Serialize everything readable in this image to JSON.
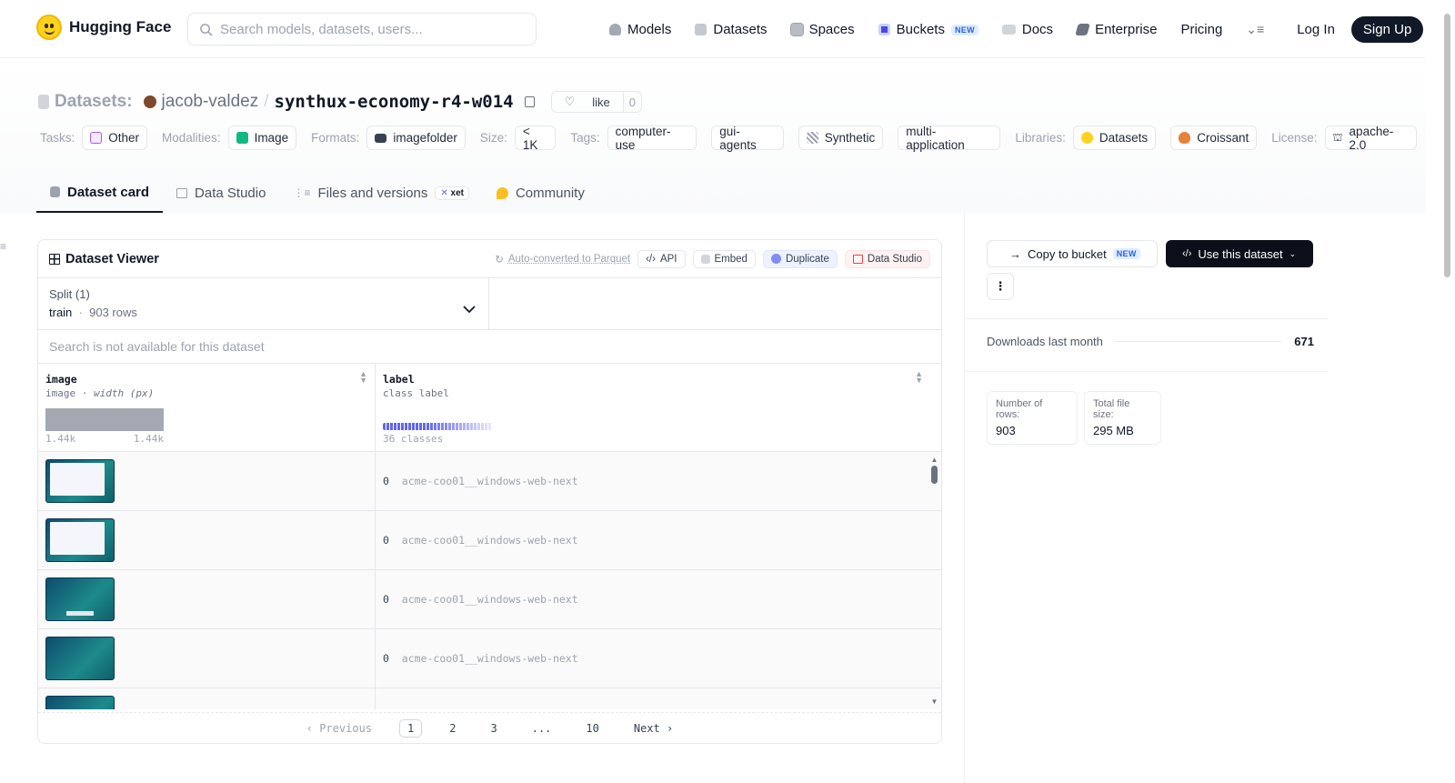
{
  "nav": {
    "logo": "Hugging Face",
    "search_placeholder": "Search models, datasets, users...",
    "links": [
      {
        "label": "Models",
        "icon": "models-icon",
        "color": "#9ca3af"
      },
      {
        "label": "Datasets",
        "icon": "datasets-icon",
        "color": "#9ca3af"
      },
      {
        "label": "Spaces",
        "icon": "spaces-icon",
        "color": "#9ca3af"
      },
      {
        "label": "Buckets",
        "icon": "buckets-icon",
        "color": "#4f46e5"
      },
      {
        "label": "Docs",
        "icon": "docs-icon",
        "color": "#9ca3af"
      },
      {
        "label": "Enterprise",
        "icon": "enterprise-icon",
        "color": "#6b7280"
      },
      {
        "label": "Pricing"
      }
    ],
    "new_badge": "NEW",
    "login": "Log In",
    "signup": "Sign Up"
  },
  "header": {
    "section": "Datasets:",
    "owner": "jacob-valdez",
    "slash": "/",
    "name": "synthux-economy-r4-w014",
    "like": "like",
    "like_count": "0",
    "tags": [
      {
        "label": "Tasks:",
        "items": [
          {
            "text": "Other",
            "icon": "other-icon"
          }
        ]
      },
      {
        "label": "Modalities:",
        "items": [
          {
            "text": "Image",
            "icon": "image-icon"
          }
        ]
      },
      {
        "label": "Formats:",
        "items": [
          {
            "text": "imagefolder",
            "icon": "folder-icon"
          }
        ]
      },
      {
        "label": "Size:",
        "items": [
          {
            "text": "< 1K"
          }
        ]
      },
      {
        "label": "Tags:",
        "items": [
          {
            "text": "computer-use"
          },
          {
            "text": "gui-agents"
          },
          {
            "text": "Synthetic",
            "icon": "synthetic-icon"
          },
          {
            "text": "multi-application"
          }
        ]
      },
      {
        "label": "Libraries:",
        "items": [
          {
            "text": "Datasets",
            "icon": "hf-icon"
          },
          {
            "text": "Croissant",
            "icon": "croissant-icon"
          }
        ]
      },
      {
        "label": "License:",
        "items": [
          {
            "text": "apache-2.0",
            "icon": "license-icon"
          }
        ]
      }
    ]
  },
  "tabs": [
    {
      "label": "Dataset card",
      "active": true
    },
    {
      "label": "Data Studio"
    },
    {
      "label": "Files and versions",
      "badge": "xet"
    },
    {
      "label": "Community"
    }
  ],
  "viewer": {
    "title": "Dataset Viewer",
    "auto_converted": "Auto-converted to Parquet",
    "buttons": [
      "API",
      "Embed",
      "Duplicate",
      "Data Studio"
    ],
    "split_label": "Split (1)",
    "split_value": "train",
    "split_rows": "903 rows",
    "search_na": "Search is not available for this dataset",
    "col1_name": "image",
    "col1_type": "image",
    "col1_sub": "width (px)",
    "col1_min": "1.44k",
    "col1_max": "1.44k",
    "col2_name": "label",
    "col2_type": "class label",
    "col2_classes": "36 classes",
    "rows": [
      {
        "label_index": "0",
        "label_text": "acme-coo01__windows-web-next"
      },
      {
        "label_index": "0",
        "label_text": "acme-coo01__windows-web-next"
      },
      {
        "label_index": "0",
        "label_text": "acme-coo01__windows-web-next"
      },
      {
        "label_index": "0",
        "label_text": "acme-coo01__windows-web-next"
      }
    ],
    "pager": {
      "prev": "Previous",
      "pages": [
        "1",
        "2",
        "3",
        "...",
        "10"
      ],
      "next": "Next"
    }
  },
  "sidebar": {
    "copy_bucket": "Copy to bucket",
    "new_badge": "NEW",
    "use_dataset": "Use this dataset",
    "downloads_label": "Downloads last month",
    "downloads_value": "671",
    "rows_label": "Number of rows:",
    "rows_value": "903",
    "size_label": "Total file size:",
    "size_value": "295 MB"
  }
}
